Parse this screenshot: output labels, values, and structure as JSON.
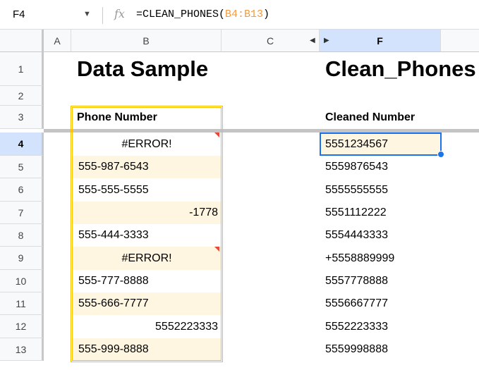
{
  "formula_bar": {
    "name_box": "F4",
    "fx_icon": "fx",
    "formula_prefix": "=CLEAN_PHONES(",
    "formula_range": "B4:B13",
    "formula_suffix": ")"
  },
  "columns": [
    "A",
    "B",
    "C",
    "F"
  ],
  "rows": [
    "1",
    "2",
    "3",
    "4",
    "5",
    "6",
    "7",
    "8",
    "9",
    "10",
    "11",
    "12",
    "13"
  ],
  "titles": {
    "left": "Data Sample",
    "right": "Clean_Phones"
  },
  "headers": {
    "phone": "Phone Number",
    "cleaned": "Cleaned Number"
  },
  "phone_numbers": [
    "#ERROR!",
    "555-987-6543",
    "555-555-5555",
    "-1778",
    "555-444-3333",
    "#ERROR!",
    "555-777-8888",
    "555-666-7777",
    "5552223333",
    "555-999-8888"
  ],
  "cleaned_numbers": [
    "5551234567",
    "5559876543",
    "5555555555",
    "5551112222",
    "5554443333",
    "+5558889999",
    "5557778888",
    "5556667777",
    "5552223333",
    "5559998888"
  ],
  "colors": {
    "selection": "#1a73e8",
    "range_border": "#fbbc04",
    "error_marker": "#e8473b"
  }
}
